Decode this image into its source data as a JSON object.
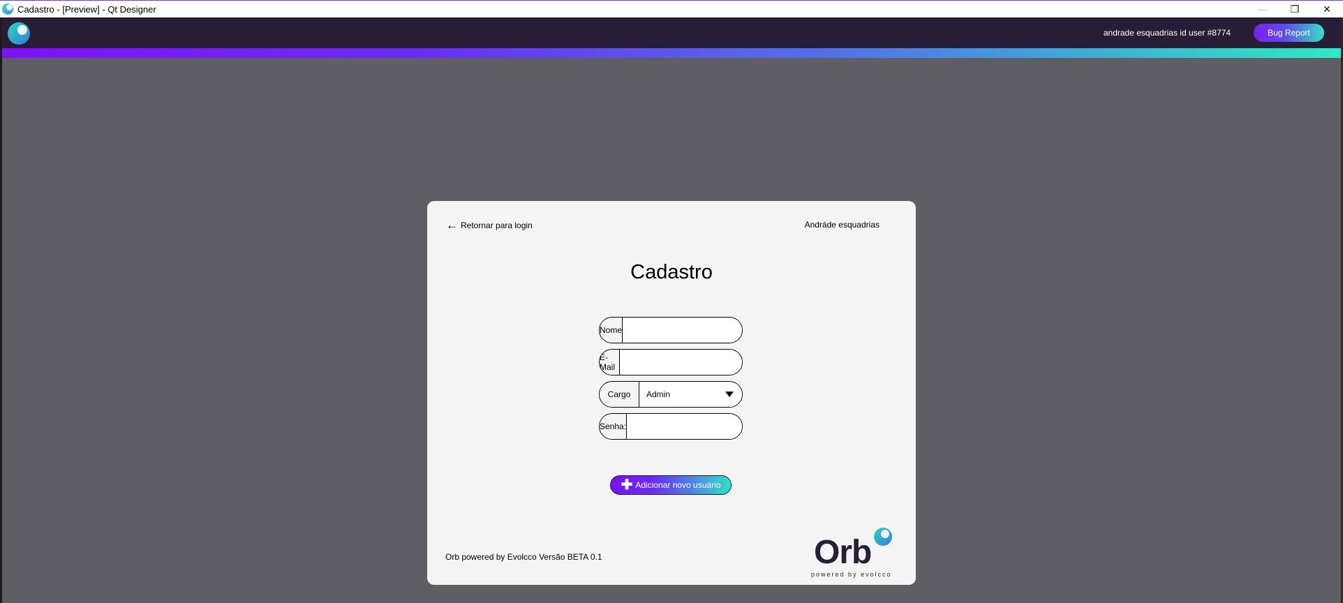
{
  "window": {
    "title": "Cadastro - [Preview] - Qt Designer",
    "controls": {
      "minimize": "—",
      "restore": "❐",
      "close": "✕"
    }
  },
  "header": {
    "user_id_text": "andrade esquadrias id user #8774",
    "bug_report_label": "Bug Report"
  },
  "card": {
    "back_label": "Retornar para login",
    "company_name": "Andráde esquadrias",
    "title": "Cadastro",
    "fields": {
      "nome": {
        "label": "Nome",
        "value": ""
      },
      "email": {
        "label": "E-Mail",
        "value": ""
      },
      "cargo": {
        "label": "Cargo",
        "selected": "Admin"
      },
      "senha": {
        "label": "Senha:",
        "value": ""
      }
    },
    "add_button_label": "Adicionar novo usuário",
    "footer_text": "Orb powered by Evolcco Versão BETA 0.1",
    "logo": {
      "word": "Orb",
      "tagline": "powered by evolcco"
    }
  },
  "colors": {
    "header_bg": "#281d36",
    "background": "#605e65",
    "card_bg": "#f4f4f4",
    "accent_purple": "#7512f4",
    "accent_teal": "#30e3c4"
  }
}
